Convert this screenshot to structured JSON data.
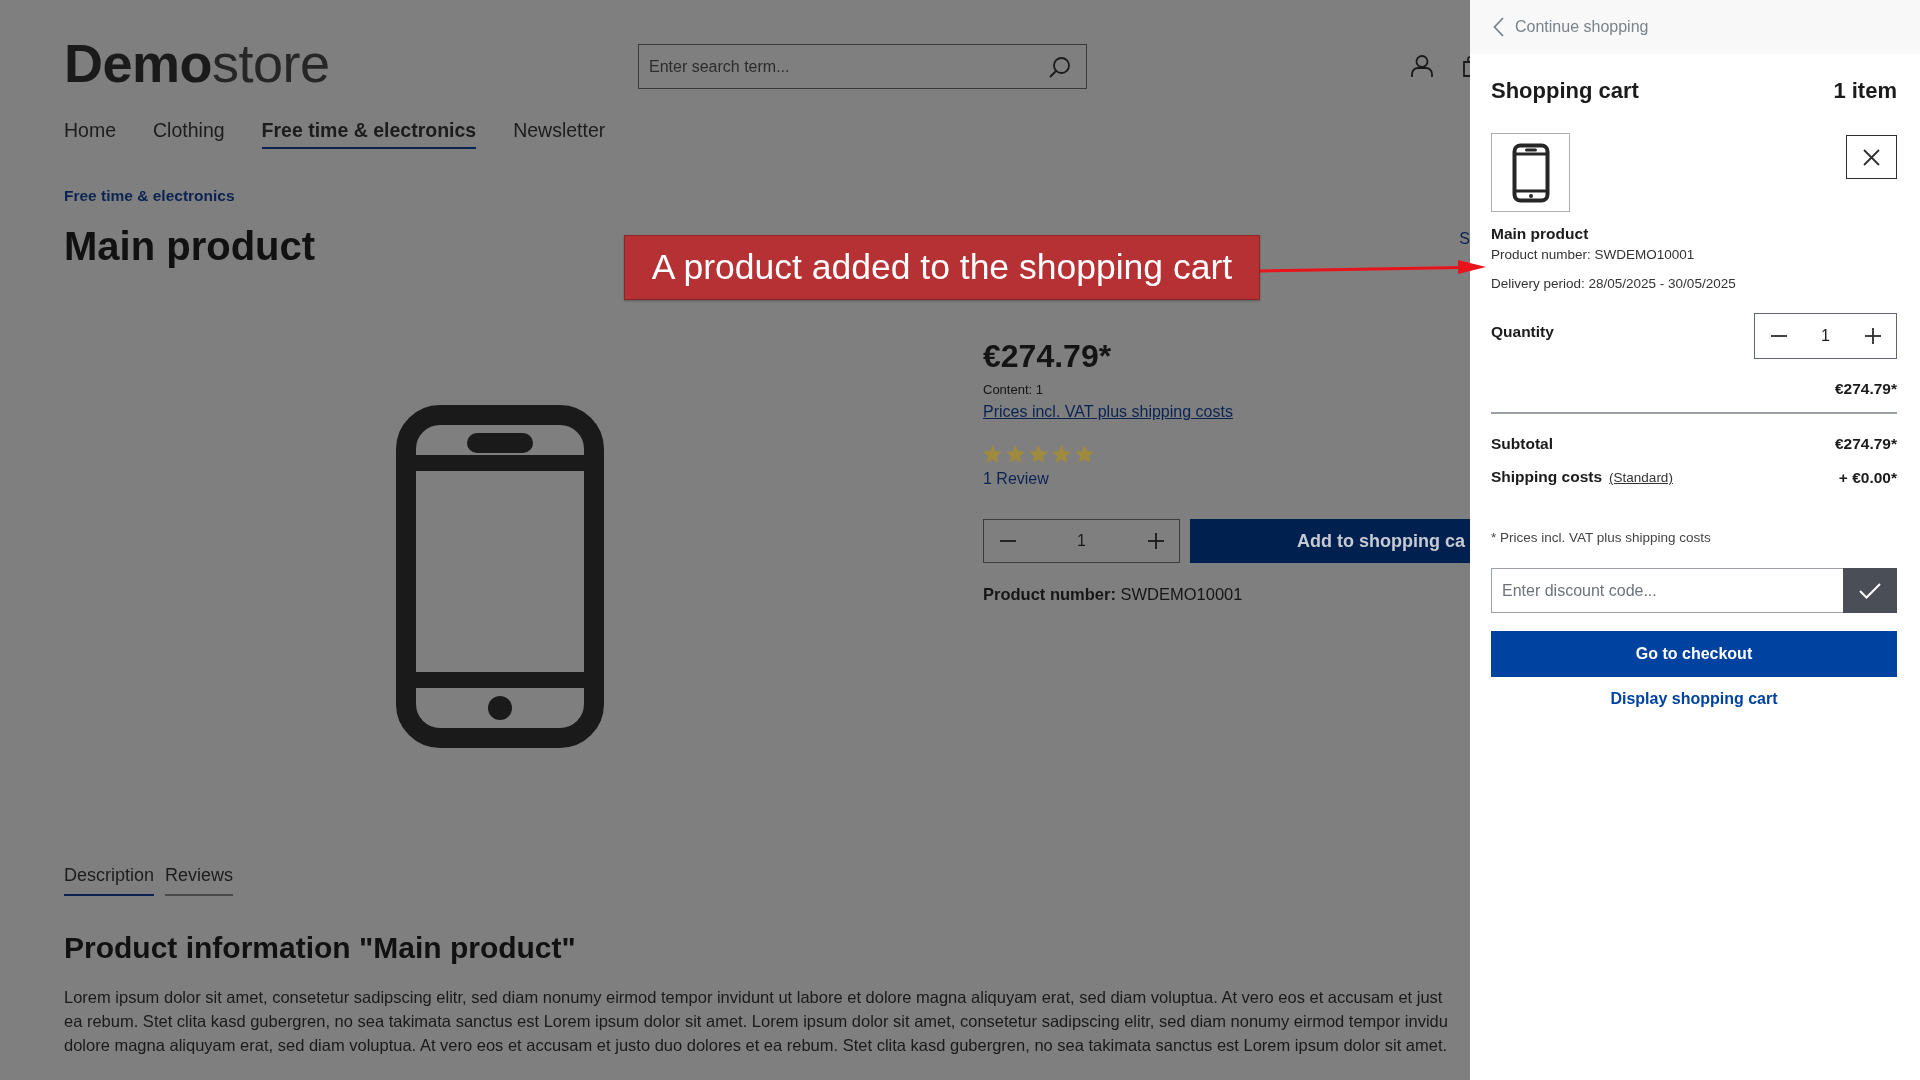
{
  "header": {
    "logo": "**Demo**store",
    "search": {
      "placeholder": "Enter search term..."
    }
  },
  "nav": [
    {
      "label": "Home",
      "selected": false
    },
    {
      "label": "Clothing",
      "selected": false
    },
    {
      "label": "Free time & electronics",
      "selected": true
    },
    {
      "label": "Newsletter",
      "selected": false
    }
  ],
  "breadcrumb": "Free time & electronics",
  "product": {
    "title": "Main product",
    "side_text": "S",
    "price": "€274.79*",
    "content": "Content: 1",
    "tax_link": "Prices incl. VAT plus shipping costs",
    "stars": 5,
    "reviews_link": "1 Review",
    "quantity": "1",
    "add_button": "Add to shopping ca",
    "number": "**Product number:** SWDEMO10001"
  },
  "tabs": [
    {
      "label": "Description",
      "selected": true
    },
    {
      "label": "Reviews",
      "selected": false
    }
  ],
  "description": {
    "heading": "Product information \"Main product\"",
    "lines": [
      "Lorem ipsum dolor sit amet, consetetur sadipscing elitr, sed diam nonumy eirmod tempor invidunt ut labore et dolore magna aliquyam erat, sed diam voluptua. At vero eos et accusam et just",
      "ea rebum. Stet clita kasd gubergren, no sea takimata sanctus est Lorem ipsum dolor sit amet. Lorem ipsum dolor sit amet, consetetur sadipscing elitr, sed diam nonumy eirmod tempor invidu",
      "dolore magna aliquyam erat, sed diam voluptua. At vero eos et accusam et justo duo dolores et ea rebum. Stet clita kasd gubergren, no sea takimata sanctus est Lorem ipsum dolor sit amet."
    ]
  },
  "annotation": {
    "text": "A product added to the shopping cart"
  },
  "cart": {
    "back_link": "Continue shopping",
    "title": "Shopping cart",
    "count": "1 item",
    "items": [
      {
        "name": "Main product",
        "number": "Product number: SWDEMO10001",
        "delivery": "Delivery period: 28/05/2025 - 30/05/2025",
        "quantity_label": "Quantity",
        "quantity": "1",
        "price": "€274.79*"
      }
    ],
    "subtotal_label": "Subtotal",
    "subtotal": "€274.79*",
    "shipping_label": "Shipping costs",
    "shipping_method": "(Standard)",
    "shipping": "+ €0.00*",
    "note": "* Prices incl. VAT plus shipping costs",
    "discount": {
      "placeholder": "Enter discount code..."
    },
    "checkout_button": "Go to checkout",
    "view_cart_link": "Display shopping cart"
  }
}
